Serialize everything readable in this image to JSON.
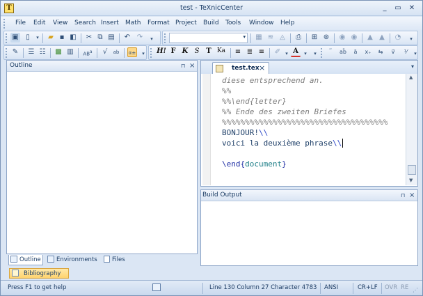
{
  "window": {
    "title": "test - TeXnicCenter",
    "app_icon_letter": "T"
  },
  "menu": [
    "File",
    "Edit",
    "View",
    "Search",
    "Insert",
    "Math",
    "Format",
    "Project",
    "Build",
    "Tools",
    "Window",
    "Help"
  ],
  "toolbar2_text": {
    "bold_h": "H!",
    "bold": "F",
    "italic": "K",
    "slant": "S",
    "typewriter": "T",
    "smallcaps": "Ka",
    "sub": "AB",
    "font_color": "A"
  },
  "outline_panel": {
    "title": "Outline",
    "pin": "⊓",
    "close": "×"
  },
  "left_tabs": [
    "Outline",
    "Environments",
    "Files"
  ],
  "bibliography_tab": "Bibliography",
  "editor": {
    "tab_label": "test.tex",
    "lines": [
      {
        "kind": "comment",
        "text": "diese entsprechend an."
      },
      {
        "kind": "comment",
        "text": "%%"
      },
      {
        "kind": "comment",
        "text": "%%\\end{letter}"
      },
      {
        "kind": "comment",
        "text": "%% Ende des zweiten Briefes"
      },
      {
        "kind": "comment",
        "text": "%%%%%%%%%%%%%%%%%%%%%%%%%%%%%%%%%%%%"
      },
      {
        "kind": "plain",
        "text": "BONJOUR!",
        "tail": "\\\\"
      },
      {
        "kind": "plain",
        "text": "voici la deuxième phrase",
        "tail": "\\\\"
      },
      {
        "kind": "blank",
        "text": ""
      },
      {
        "kind": "end",
        "cmd": "\\end",
        "open": "{",
        "arg": "document",
        "close": "}"
      }
    ]
  },
  "build_output": {
    "title": "Build Output",
    "pin": "⊓",
    "close": "×"
  },
  "status": {
    "help": "Press F1 to get help",
    "position": "Line 130 Column 27 Character 4783",
    "encoding": "ANSI",
    "line_ending": "CR+LF",
    "ovr": "OVR",
    "rec": "RE"
  }
}
